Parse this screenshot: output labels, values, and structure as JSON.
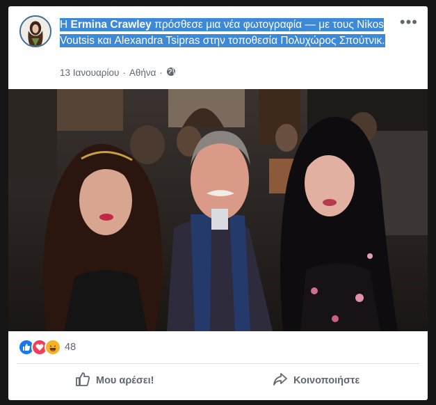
{
  "post": {
    "prefix": "Η ",
    "author": "Ermina Crawley",
    "action_text": " πρόσθεσε μια νέα φωτογραφία — με τους Nikos Voutsis και Alexandra Tsipras στην τοποθεσία Πολυχώρος Σπούτνικ.",
    "date": "13 Ιανουαρίου",
    "sep": "·",
    "location": "Αθήνα",
    "more_label": "•••"
  },
  "reactions": {
    "count": "48",
    "types": [
      "like-icon",
      "love-icon",
      "haha-icon"
    ]
  },
  "actions": {
    "like_label": "Μου αρέσει!",
    "share_label": "Κοινοποιήστε"
  },
  "colors": {
    "highlight": "#3d88d7",
    "like_blue": "#1877f2",
    "love_red": "#f33e58",
    "haha_yellow": "#f7b125",
    "text_gray": "#606770"
  }
}
